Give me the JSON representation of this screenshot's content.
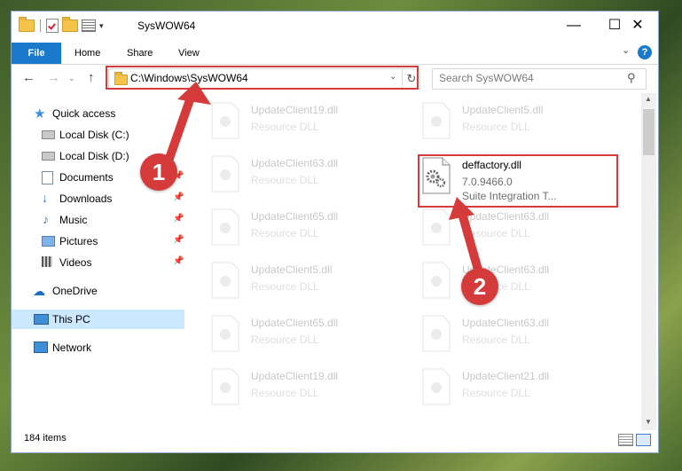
{
  "window": {
    "title": "SysWOW64"
  },
  "ribbon": {
    "tabs": [
      "File",
      "Home",
      "Share",
      "View"
    ]
  },
  "address": {
    "path": "C:\\Windows\\SysWOW64"
  },
  "search": {
    "placeholder": "Search SysWOW64"
  },
  "sidebar": {
    "items": [
      {
        "label": "Quick access",
        "icon": "star-icon"
      },
      {
        "label": "Local Disk (C:)",
        "icon": "drive-icon"
      },
      {
        "label": "Local Disk (D:)",
        "icon": "drive-icon"
      },
      {
        "label": "Documents",
        "icon": "documents-icon",
        "pinned": true
      },
      {
        "label": "Downloads",
        "icon": "download-icon",
        "pinned": true
      },
      {
        "label": "Music",
        "icon": "music-icon",
        "pinned": true
      },
      {
        "label": "Pictures",
        "icon": "pictures-icon",
        "pinned": true
      },
      {
        "label": "Videos",
        "icon": "videos-icon",
        "pinned": true
      },
      {
        "label": "OneDrive",
        "icon": "cloud-icon"
      },
      {
        "label": "This PC",
        "icon": "computer-icon",
        "selected": true
      },
      {
        "label": "Network",
        "icon": "network-icon"
      }
    ]
  },
  "files": {
    "highlighted": {
      "name": "deffactory.dll",
      "version": "7.0.9466.0",
      "description": "Suite Integration T..."
    },
    "col1": [
      {
        "name": "UpdateClient19.dll",
        "type": "Resource DLL"
      },
      {
        "name": "UpdateClient63.dll",
        "type": "Resource DLL"
      },
      {
        "name": "UpdateClient65.dll",
        "type": "Resource DLL"
      },
      {
        "name": "UpdateClient5.dll",
        "type": "Resource DLL"
      },
      {
        "name": "UpdateClient65.dll",
        "type": "Resource DLL"
      },
      {
        "name": "UpdateClient19.dll",
        "type": "Resource DLL"
      }
    ],
    "col2": [
      {
        "name": "UpdateClient5.dll",
        "type": "Resource DLL"
      },
      {
        "name": "UpdateClient63.dll",
        "type": "Resource DLL"
      },
      {
        "name": "UpdateClient63.dll",
        "type": "Resource DLL"
      },
      {
        "name": "UpdateClient63.dll",
        "type": "Resource DLL"
      },
      {
        "name": "UpdateClient21.dll",
        "type": "Resource DLL"
      }
    ]
  },
  "status": {
    "item_count": "184 items"
  },
  "annotations": {
    "badge1": "1",
    "badge2": "2",
    "color": "#d53b3b"
  }
}
